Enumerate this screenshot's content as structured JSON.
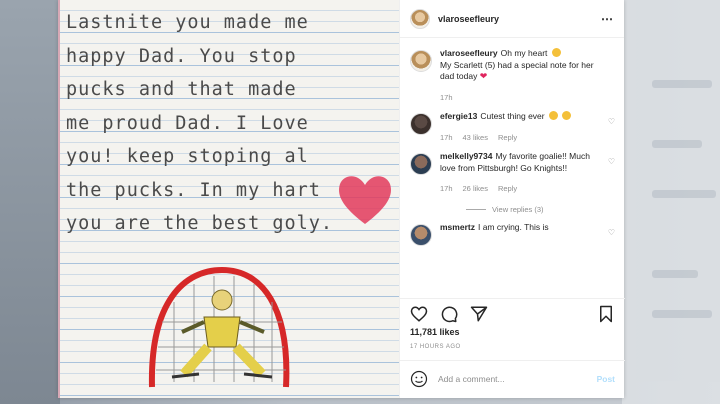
{
  "photo": {
    "handwriting": [
      "Lastnite  you  made  me",
      "happy  Dad.  You  stop",
      "pucks   and   that  made",
      "me  proud  Dad. I  Love",
      "you!  keep  stoping   al",
      "the  pucks.  In  my  hart",
      "you  are  the  best  goly."
    ]
  },
  "header": {
    "username": "vlaroseefleury",
    "more_icon": "⋯"
  },
  "caption": {
    "username": "vlaroseefleury",
    "text_1": "Oh my heart",
    "text_2": "My Scarlett (5) had a special note for her dad today",
    "time": "17h"
  },
  "comments": [
    {
      "username": "efergie13",
      "text": "Cutest thing ever",
      "time": "17h",
      "likes": "43 likes",
      "reply": "Reply"
    },
    {
      "username": "melkelly9734",
      "text": "My favorite goalie!! Much love from Pittsburgh! Go Knights!!",
      "time": "17h",
      "likes": "26 likes",
      "reply": "Reply"
    },
    {
      "username": "msmertz",
      "text": "I am crying. This is"
    }
  ],
  "view_replies": "View replies (3)",
  "likes_count": "11,781 likes",
  "time_ago": "17 HOURS AGO",
  "add_comment": {
    "placeholder": "Add a comment...",
    "post_label": "Post"
  },
  "colors": {
    "accent": "#0095f6",
    "post_disabled": "#b2dffc",
    "heart": "#e0245e"
  }
}
